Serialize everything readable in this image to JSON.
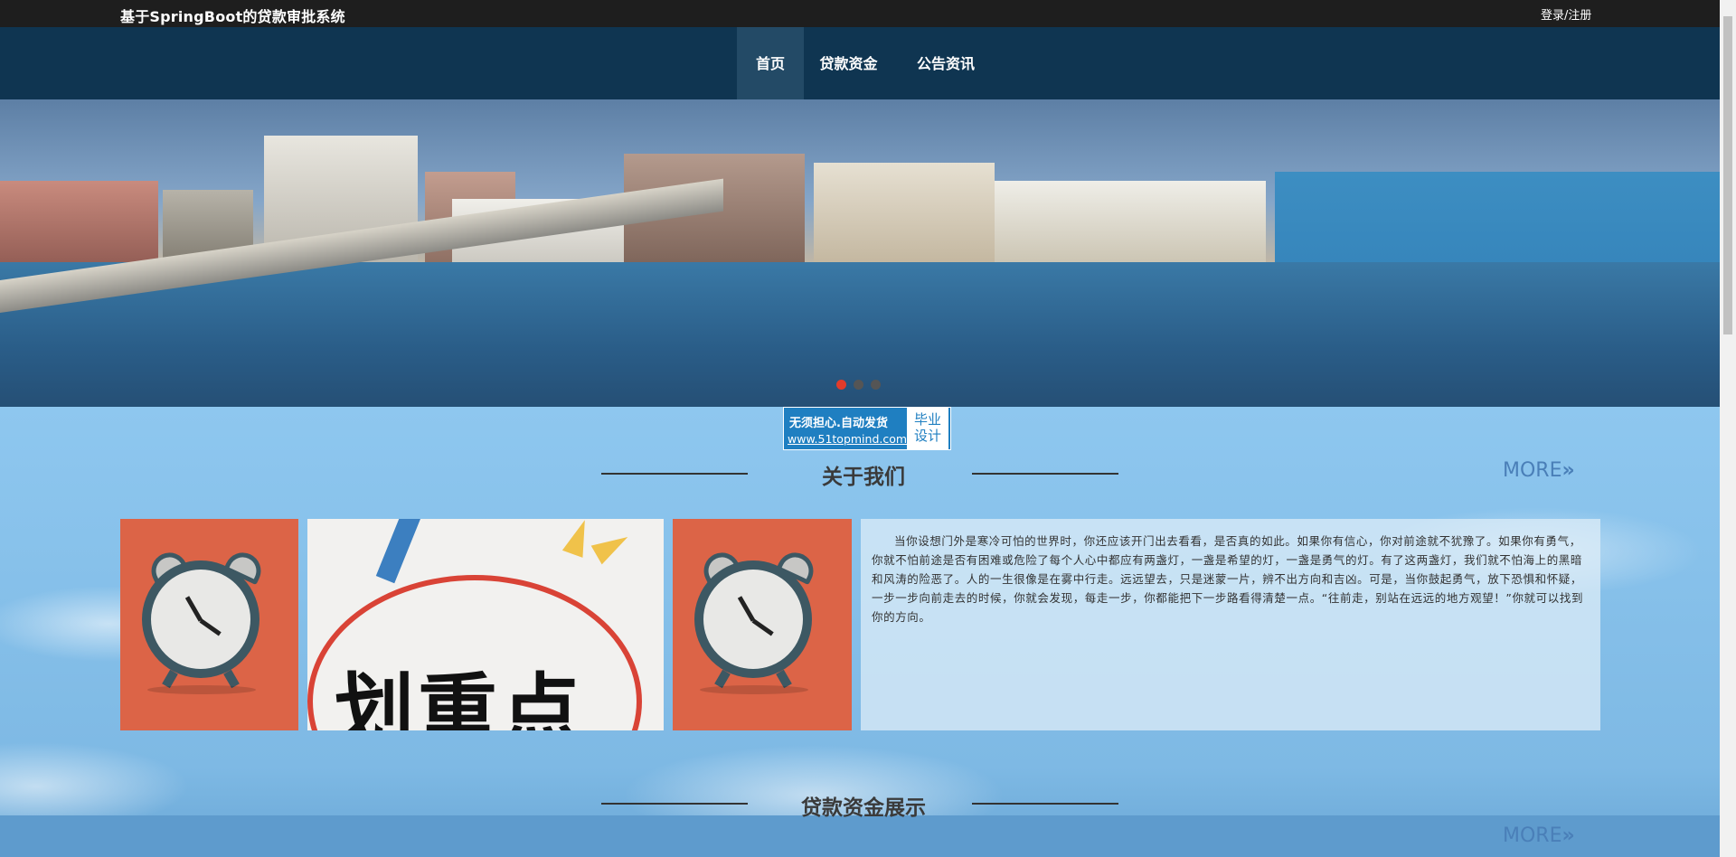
{
  "header": {
    "site_title": "基于SpringBoot的贷款审批系统",
    "auth_link": "登录/注册"
  },
  "nav": {
    "items": [
      {
        "label": "首页",
        "active": true
      },
      {
        "label": "贷款资金",
        "active": false
      },
      {
        "label": "公告资讯",
        "active": false
      }
    ]
  },
  "carousel": {
    "slide_count": 3,
    "active_index": 0,
    "indicator_active_color": "#e23b2a"
  },
  "watermark": {
    "line1": "无须担心.自动发货",
    "line2": "www.51topmind.com",
    "box_line1": "毕业",
    "box_line2": "设计"
  },
  "about": {
    "title": "关于我们",
    "more": "MORE",
    "text": "当你设想门外是寒冷可怕的世界时，你还应该开门出去看看，是否真的如此。如果你有信心，你对前途就不犹豫了。如果你有勇气，你就不怕前途是否有困难或危险了每个人心中都应有两盏灯，一盏是希望的灯，一盏是勇气的灯。有了这两盏灯，我们就不怕海上的黑暗和风涛的险恶了。人的一生很像是在雾中行走。远远望去，只是迷蒙一片，辨不出方向和吉凶。可是，当你鼓起勇气，放下恐惧和怀疑，一步一步向前走去的时候，你就会发现，每走一步，你都能把下一步路看得清楚一点。“往前走，别站在远远的地方观望！”你就可以找到你的方向。",
    "image_text": "划重点"
  },
  "loans": {
    "title": "贷款资金展示",
    "more": "MORE"
  },
  "colors": {
    "topbar": "#1e1e1e",
    "navbar": "#0f3551",
    "accent_more": "#4a7fb8",
    "clock_bg": "#dc6447"
  }
}
